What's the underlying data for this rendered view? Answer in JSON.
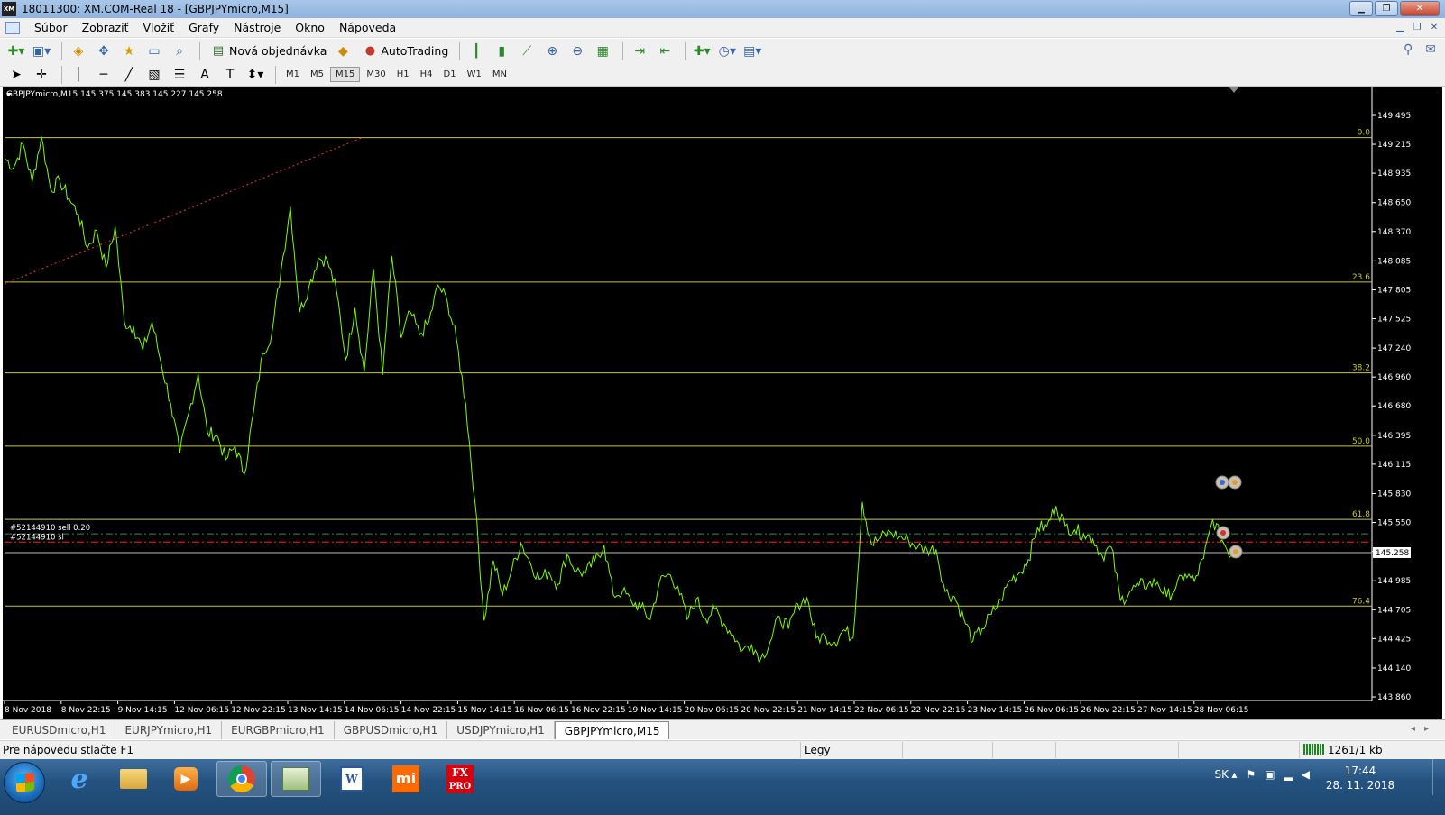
{
  "window": {
    "title": "18011300: XM.COM-Real 18 - [GBPJPYmicro,M15]",
    "app_icon_text": "XM"
  },
  "menu": [
    "Súbor",
    "Zobraziť",
    "Vložiť",
    "Grafy",
    "Nástroje",
    "Okno",
    "Nápoveda"
  ],
  "toolbar": {
    "new_order_label": "Nová objednávka",
    "autotrading_label": "AutoTrading",
    "timeframes": [
      "M1",
      "M5",
      "M15",
      "M30",
      "H1",
      "H4",
      "D1",
      "W1",
      "MN"
    ],
    "active_timeframe": "M15"
  },
  "chart": {
    "header": "GBPJPYmicro,M15  145.375 145.383 145.227 145.258",
    "current_price": "145.258",
    "order_label_1": "#52144910 sell 0.20",
    "order_label_2": "#52144910 sl",
    "colors": {
      "background": "#000000",
      "price_line": "#7cfc00",
      "fib_line": "#c8c83c",
      "order_line": "#2e8b57",
      "sl_line": "#ff2020"
    }
  },
  "chart_data": {
    "type": "line",
    "y_tick_labels": [
      "149.495",
      "149.215",
      "148.935",
      "148.650",
      "148.370",
      "148.085",
      "147.805",
      "147.525",
      "147.240",
      "146.960",
      "146.680",
      "146.395",
      "146.115",
      "145.830",
      "145.550",
      "145.270",
      "144.985",
      "144.705",
      "144.425",
      "144.140",
      "143.860"
    ],
    "x_tick_labels": [
      "8 Nov 2018",
      "8 Nov 22:15",
      "9 Nov 14:15",
      "12 Nov 06:15",
      "12 Nov 22:15",
      "13 Nov 14:15",
      "14 Nov 06:15",
      "14 Nov 22:15",
      "15 Nov 14:15",
      "16 Nov 06:15",
      "16 Nov 22:15",
      "19 Nov 14:15",
      "20 Nov 06:15",
      "20 Nov 22:15",
      "21 Nov 14:15",
      "22 Nov 06:15",
      "22 Nov 22:15",
      "23 Nov 14:15",
      "26 Nov 06:15",
      "26 Nov 22:15",
      "27 Nov 14:15",
      "28 Nov 06:15"
    ],
    "ylim": [
      143.86,
      149.495
    ],
    "fibonacci_levels": [
      {
        "label": "0.0",
        "price": 149.28
      },
      {
        "label": "23.6",
        "price": 147.88
      },
      {
        "label": "38.2",
        "price": 147.0
      },
      {
        "label": "50.0",
        "price": 146.29
      },
      {
        "label": "61.8",
        "price": 145.58
      },
      {
        "label": "76.4",
        "price": 144.74
      }
    ],
    "series": [
      {
        "values": [
          149.08,
          148.99,
          149.22,
          148.85,
          149.29,
          148.78,
          148.86,
          148.69,
          148.54,
          148.21,
          148.38,
          148.02,
          148.42,
          147.49,
          147.44,
          147.22,
          147.49,
          147.09,
          146.71,
          146.22,
          146.62,
          146.99,
          146.42,
          146.4,
          146.16,
          146.29,
          146.02,
          146.62,
          147.19,
          147.39,
          148.01,
          148.61,
          147.59,
          147.83,
          148.11,
          148.09,
          147.79,
          147.13,
          147.63,
          147.01,
          148.01,
          146.98,
          148.13,
          147.34,
          147.59,
          147.37,
          147.49,
          147.85,
          147.7,
          147.32,
          146.7,
          145.76,
          144.6,
          145.18,
          144.85,
          145.09,
          145.35,
          145.16,
          145.0,
          145.07,
          144.95,
          145.24,
          145.08,
          145.06,
          145.18,
          145.33,
          144.85,
          144.88,
          144.78,
          144.73,
          144.61,
          144.97,
          145.05,
          144.93,
          144.61,
          144.81,
          144.62,
          144.71,
          144.57,
          144.46,
          144.31,
          144.37,
          144.23,
          144.39,
          144.64,
          144.52,
          144.76,
          144.82,
          144.43,
          144.45,
          144.39,
          144.51,
          144.43,
          145.75,
          145.34,
          145.4,
          145.46,
          145.41,
          145.38,
          145.31,
          145.29,
          145.29,
          144.88,
          144.83,
          144.62,
          144.4,
          144.52,
          144.66,
          144.8,
          144.99,
          145.06,
          145.19,
          145.5,
          145.51,
          145.71,
          145.52,
          145.48,
          145.44,
          145.39,
          145.23,
          145.31,
          144.79,
          144.88,
          144.94,
          144.95,
          144.97,
          144.83,
          144.92,
          145.05,
          144.98,
          145.2,
          145.58,
          145.38,
          145.23
        ],
        "note_points": 132
      }
    ]
  },
  "tabs": [
    "EURUSDmicro,H1",
    "EURJPYmicro,H1",
    "EURGBPmicro,H1",
    "GBPUSDmicro,H1",
    "USDJPYmicro,H1",
    "GBPJPYmicro,M15"
  ],
  "active_tab": "GBPJPYmicro,M15",
  "status": {
    "help": "Pre nápovedu stlačte F1",
    "profile": "Legy",
    "traffic": "1261/1 kb"
  },
  "taskbar": {
    "lang": "SK",
    "time": "17:44",
    "date": "28. 11. 2018",
    "fxpro_text_1": "FX",
    "fxpro_text_2": "PRO",
    "mi_text": "mi"
  }
}
